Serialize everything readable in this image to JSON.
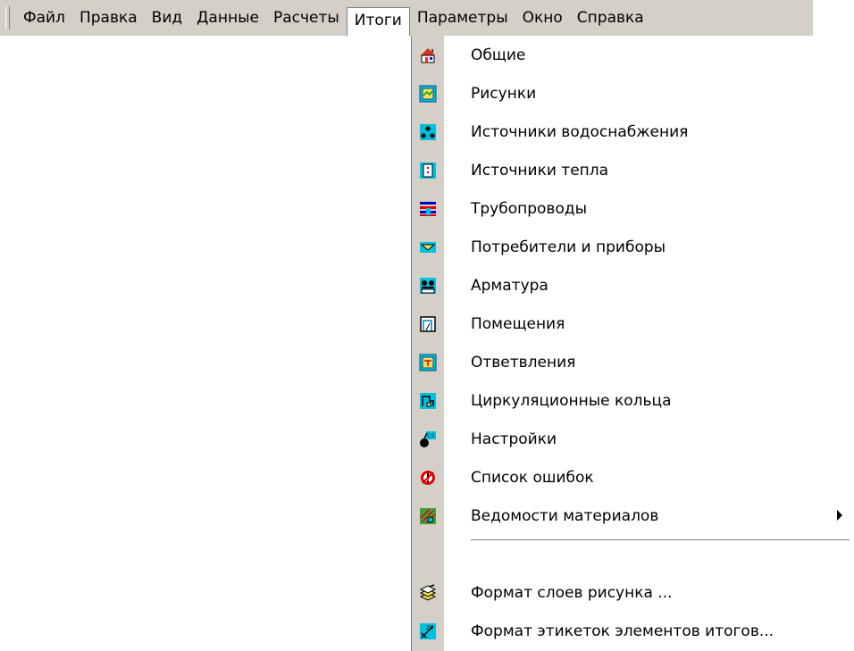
{
  "menubar": {
    "items": [
      {
        "label": "Файл"
      },
      {
        "label": "Правка"
      },
      {
        "label": "Вид"
      },
      {
        "label": "Данные"
      },
      {
        "label": "Расчеты"
      },
      {
        "label": "Итоги"
      },
      {
        "label": "Параметры"
      },
      {
        "label": "Окно"
      },
      {
        "label": "Справка"
      }
    ]
  },
  "itogi_menu": {
    "items": [
      {
        "label": "Общие",
        "icon": "house-icon"
      },
      {
        "label": "Рисунки",
        "icon": "drawings-icon"
      },
      {
        "label": "Источники водоснабжения",
        "icon": "water-source-icon"
      },
      {
        "label": "Источники тепла",
        "icon": "heat-source-icon"
      },
      {
        "label": "Трубопроводы",
        "icon": "pipelines-icon"
      },
      {
        "label": "Потребители и приборы",
        "icon": "consumers-icon"
      },
      {
        "label": "Арматура",
        "icon": "fittings-icon"
      },
      {
        "label": "Помещения",
        "icon": "rooms-icon"
      },
      {
        "label": "Ответвления",
        "icon": "branches-icon"
      },
      {
        "label": "Циркуляционные кольца",
        "icon": "circulation-rings-icon"
      },
      {
        "label": "Настройки",
        "icon": "settings-icon"
      },
      {
        "label": "Список ошибок",
        "icon": "errors-icon"
      },
      {
        "label": "Ведомости материалов",
        "icon": "materials-icon",
        "submenu": true
      },
      {
        "label": "Формат слоев рисунка ...",
        "icon": "layers-format-icon"
      },
      {
        "label": "Формат этикеток элементов итогов...",
        "icon": "labels-format-icon"
      }
    ]
  },
  "colors": {
    "menubar_bg": "#d4d0c8",
    "icon_strip_bg": "#d4d0c8",
    "menu_bg": "#ffffff"
  }
}
